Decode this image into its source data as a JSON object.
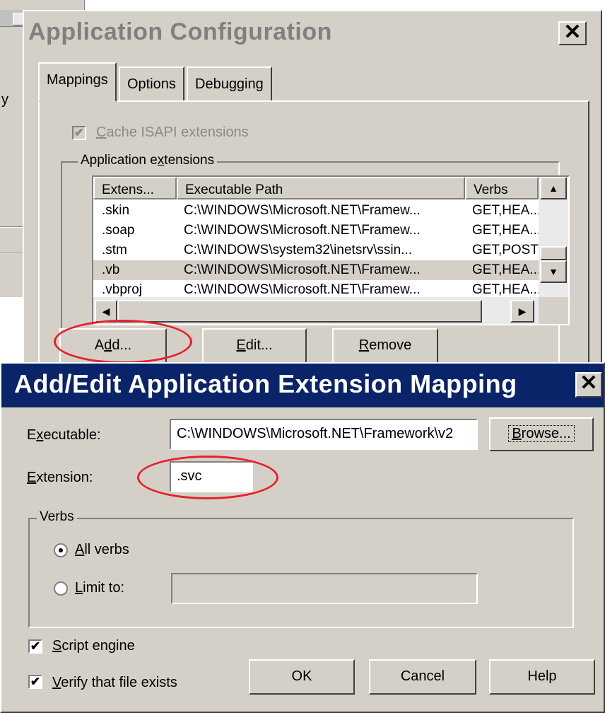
{
  "background_window": {
    "fragment_text": "y"
  },
  "app_config": {
    "title": "Application Configuration",
    "close_glyph": "✕",
    "tabs": [
      {
        "label": "Mappings",
        "active": true
      },
      {
        "label": "Options",
        "active": false
      },
      {
        "label": "Debugging",
        "active": false
      }
    ],
    "cache_isapi": {
      "label_pre": "",
      "label_accel": "C",
      "label_post": "ache ISAPI extensions",
      "checked": true,
      "enabled": false
    },
    "app_extensions_group": {
      "label_pre": "Application e",
      "label_accel": "x",
      "label_post": "tensions"
    },
    "columns": [
      "Extens...",
      "Executable Path",
      "Verbs"
    ],
    "rows": [
      {
        "ext": ".skin",
        "path": "C:\\WINDOWS\\Microsoft.NET\\Framew...",
        "verbs": "GET,HEA...",
        "selected": false
      },
      {
        "ext": ".soap",
        "path": "C:\\WINDOWS\\Microsoft.NET\\Framew...",
        "verbs": "GET,HEA...",
        "selected": false
      },
      {
        "ext": ".stm",
        "path": "C:\\WINDOWS\\system32\\inetsrv\\ssin...",
        "verbs": "GET,POST",
        "selected": false
      },
      {
        "ext": ".vb",
        "path": "C:\\WINDOWS\\Microsoft.NET\\Framew...",
        "verbs": "GET,HEA...",
        "selected": true
      },
      {
        "ext": ".vbproj",
        "path": "C:\\WINDOWS\\Microsoft.NET\\Framew...",
        "verbs": "GET,HEA...",
        "selected": false
      }
    ],
    "scroll_up_glyph": "▲",
    "scroll_down_glyph": "▼",
    "scroll_left_glyph": "◀",
    "scroll_right_glyph": "▶",
    "buttons": {
      "add": {
        "pre": "A",
        "accel": "d",
        "post": "d..."
      },
      "edit": {
        "pre": "",
        "accel": "E",
        "post": "dit..."
      },
      "remove": {
        "pre": "",
        "accel": "R",
        "post": "emove"
      }
    },
    "annotation_color": "#e8212b"
  },
  "add_edit": {
    "title": "Add/Edit Application Extension Mapping",
    "close_glyph": "✕",
    "executable": {
      "label_pre": "E",
      "label_accel": "x",
      "label_post": "ecutable:",
      "value": "C:\\WINDOWS\\Microsoft.NET\\Framework\\v2"
    },
    "browse": {
      "pre": "",
      "accel": "B",
      "post": "rowse..."
    },
    "extension": {
      "label_pre": "",
      "label_accel": "E",
      "label_post": "xtension:",
      "value": ".svc"
    },
    "verbs_group": "Verbs",
    "all_verbs": {
      "pre": "",
      "accel": "A",
      "post": "ll verbs",
      "selected": true
    },
    "limit_to": {
      "pre": "",
      "accel": "L",
      "post": "imit to:",
      "selected": false,
      "value": ""
    },
    "script_engine": {
      "pre": "",
      "accel": "S",
      "post": "cript engine",
      "checked": true
    },
    "verify_file": {
      "pre": "",
      "accel": "V",
      "post": "erify that file exists",
      "checked": true
    },
    "ok": "OK",
    "cancel": "Cancel",
    "help": "Help",
    "check_glyph": "✔"
  },
  "colors": {
    "title_bar": "#0a246a",
    "dialog_face": "#d4d0c8",
    "annotation": "#e8212b"
  }
}
